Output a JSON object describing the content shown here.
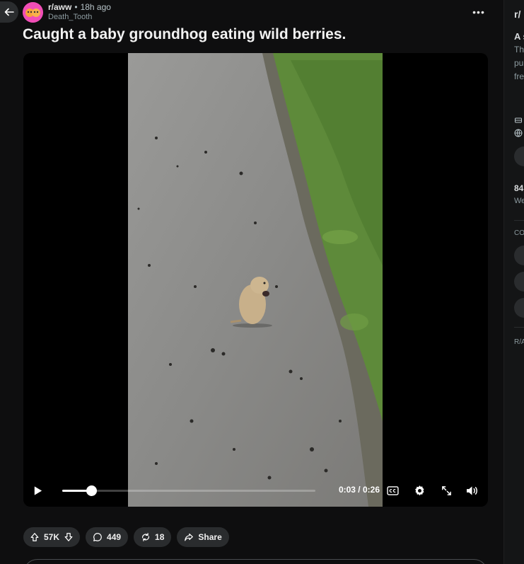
{
  "post": {
    "subreddit": "r/aww",
    "separator": "•",
    "age": "18h ago",
    "author": "Death_Tooth",
    "title": "Caught a baby groundhog eating wild berries."
  },
  "player": {
    "current_time": "0:03",
    "duration": "0:26",
    "time_display": "0:03 / 0:26",
    "progress": 0.115
  },
  "actions": {
    "votes": "57K",
    "comments": "449",
    "crossposts": "18",
    "share": "Share"
  },
  "sidebar": {
    "sub_name": "r/",
    "heading": "A s",
    "desc_lines": [
      "Th",
      "pu",
      "fre"
    ],
    "stat_value": "84",
    "stat_label": "We",
    "section_label": "CO",
    "footer": "R/A"
  },
  "colors": {
    "background": "#0e0e0f",
    "pill": "#2a2c2e",
    "avatar": "#f04eb6",
    "grass": "#5e8a3a",
    "asphalt": "#8d8d8b"
  }
}
